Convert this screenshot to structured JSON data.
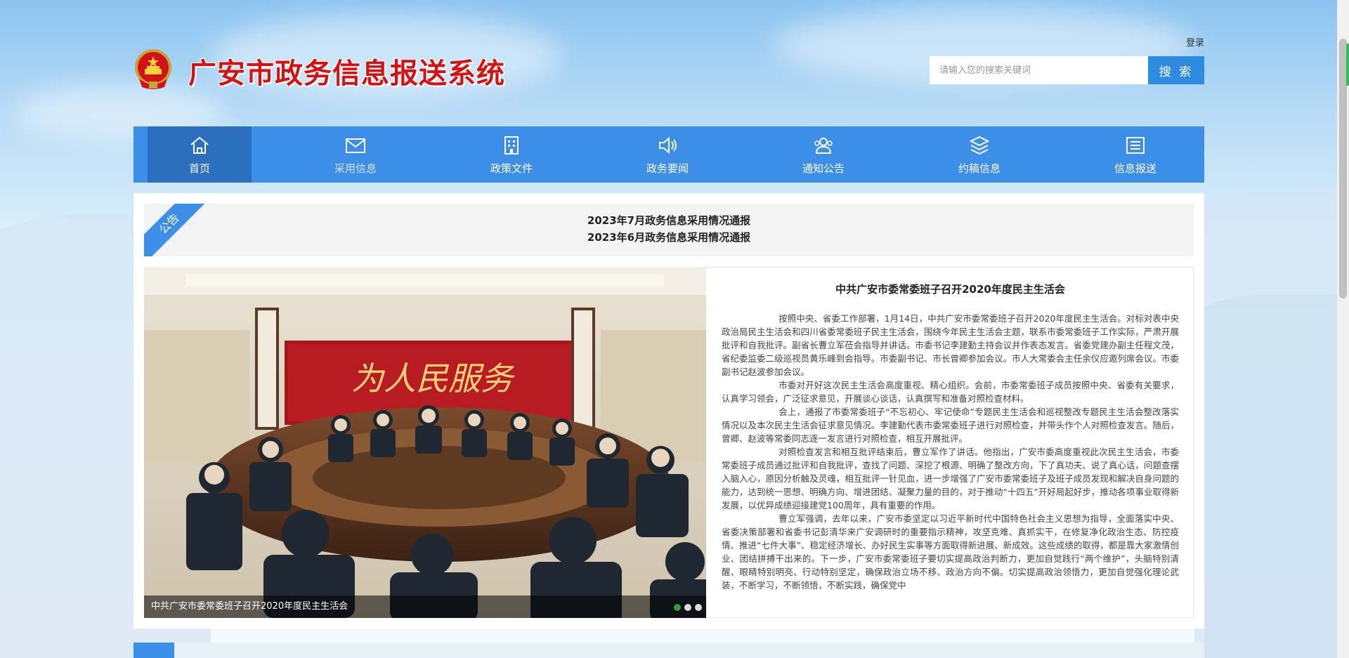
{
  "header": {
    "site_title": "广安市政务信息报送系统",
    "login_label": "登录",
    "search_placeholder": "请输入您的搜索关键词",
    "search_button": "搜 索"
  },
  "nav": {
    "items": [
      {
        "label": "首页",
        "icon": "home-icon"
      },
      {
        "label": "采用信息",
        "icon": "mail-icon"
      },
      {
        "label": "政策文件",
        "icon": "building-icon"
      },
      {
        "label": "政务要闻",
        "icon": "speaker-icon"
      },
      {
        "label": "通知公告",
        "icon": "users-icon"
      },
      {
        "label": "约稿信息",
        "icon": "layers-icon"
      },
      {
        "label": "信息报送",
        "icon": "list-icon"
      }
    ]
  },
  "notice": {
    "ribbon_label": "公告",
    "items": [
      "2023年7月政务信息采用情况通报",
      "2023年6月政务信息采用情况通报"
    ]
  },
  "slider": {
    "caption": "中共广安市委常委班子召开2020年度民主生活会",
    "banner_text": "为人民服务",
    "slide_count": 3,
    "active_slide": 1
  },
  "article": {
    "title": "中共广安市委常委班子召开2020年度民主生活会",
    "paragraphs": [
      "按照中央、省委工作部署，1月14日，中共广安市委常委班子召开2020年度民主生活会。对标对表中央政治局民主生活会和四川省委常委班子民主生活会，围绕今年民主生活会主题，联系市委常委班子工作实际，严肃开展批评和自我批评。副省长曹立军莅会指导并讲话。市委书记李建勤主持会议并作表态发言。省委党建办副主任程文茂，省纪委监委二级巡视员黄乐峰到会指导。市委副书记、市长曾卿参加会议。市人大常委会主任余仪应邀列席会议。市委副书记赵波参加会议。",
      "市委对开好这次民主生活会高度重视、精心组织。会前，市委常委班子成员按照中央、省委有关要求，认真学习领会，广泛征求意见，开展谈心谈话，认真撰写和准备对照检查材料。",
      "会上，通报了市委常委班子“不忘初心、牢记使命”专题民主生活会和巡视整改专题民主生活会整改落实情况以及本次民主生活会征求意见情况。李建勤代表市委常委班子进行对照检查，并带头作个人对照检查发言。随后，曾卿、赵波等常委同志逐一发言进行对照检查，相互开展批评。",
      "对照检查发言和相互批评结束后，曹立军作了讲话。他指出，广安市委高度重视此次民主生活会，市委常委班子成员通过批评和自我批评，查找了问题、深挖了根源、明确了整改方向，下了真功夫、说了真心话，问题查摆入脑入心，原因分析触及灵魂，相互批评一针见血，进一步增强了广安市委常委班子及班子成员发现和解决自身问题的能力，达到统一思想、明确方向、增进团结、凝聚力量的目的，对于推动“十四五”开好局起好步，推动各项事业取得新发展，以优异成绩迎接建党100周年，具有重要的作用。",
      "曹立军强调，去年以来，广安市委坚定以习近平新时代中国特色社会主义思想为指导，全面落实中央、省委决策部署和省委书记彭清华来广安调研时的重要指示精神，攻坚克难、真抓实干，在修复净化政治生态、防控疫情、推进“七件大事”、稳定经济增长、办好民生实事等方面取得新进展、新成效。这些成绩的取得，都是靠大家激情创业、团结拼搏干出来的。下一步，广安市委常委班子要切实提高政治判断力，更加自觉践行“两个维护”，头脑特别清醒、眼睛特别明亮、行动特别坚定，确保政治立场不移、政治方向不偏。切实提高政治领悟力，更加自觉强化理论武装，不断学习，不断领悟，不断实践，确保党中"
    ]
  },
  "colors": {
    "title_red": "#d21313",
    "nav_blue": "#3d8ee6",
    "nav_active": "#2d6fbf",
    "search_button": "#2f8be0",
    "dot_active": "#2e9c3f"
  }
}
